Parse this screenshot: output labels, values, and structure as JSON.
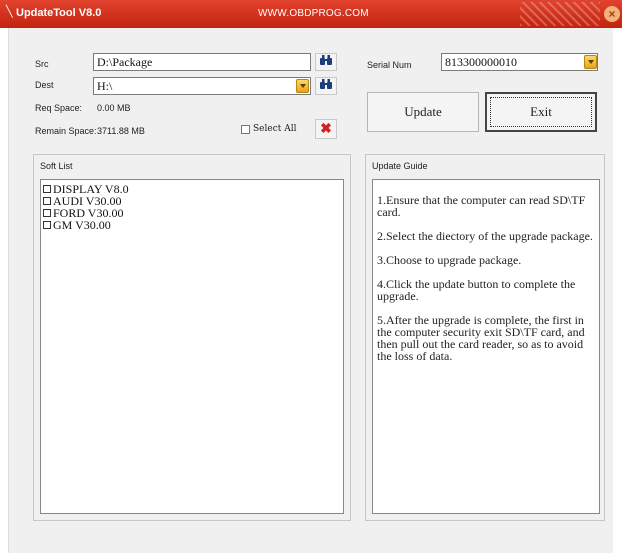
{
  "window": {
    "title": "UpdateTool  V8.0",
    "url": "WWW.OBDPROG.COM",
    "close_symbol": "×"
  },
  "form": {
    "src_label": "Src",
    "src_value": "D:\\Package",
    "dest_label": "Dest",
    "dest_value": "H:\\",
    "req_space_label": "Req Space:",
    "req_space_value": "0.00 MB",
    "remain_space_label": "Remain Space:",
    "remain_space_value": "3711.88 MB",
    "select_all_label": "Select All"
  },
  "serial": {
    "label": "Serial Num",
    "value": "813300000010"
  },
  "buttons": {
    "update_label": "Update",
    "exit_label": "Exit"
  },
  "soft_list": {
    "title": "Soft List",
    "items": [
      {
        "label": "DISPLAY V8.0"
      },
      {
        "label": "AUDI V30.00"
      },
      {
        "label": "FORD V30.00"
      },
      {
        "label": "GM V30.00"
      }
    ]
  },
  "update_guide": {
    "title": "Update Guide",
    "steps": [
      "1.Ensure that the computer can read SD\\TF card.",
      "2.Select the diectory of the upgrade package.",
      "3.Choose to upgrade package.",
      "4.Click the update button to complete the upgrade.",
      "5.After the upgrade is complete, the first in the computer security exit SD\\TF card, and then pull out the card reader, so as to avoid the loss of data."
    ]
  },
  "icons": {
    "browse": "binoculars-icon",
    "clear": "red-x-icon",
    "dropdown": "chevron-down-icon"
  },
  "colors": {
    "titlebar": "#d0301b",
    "accent_dropdown": "#f0b433",
    "clear_icon": "#d61f1f"
  }
}
